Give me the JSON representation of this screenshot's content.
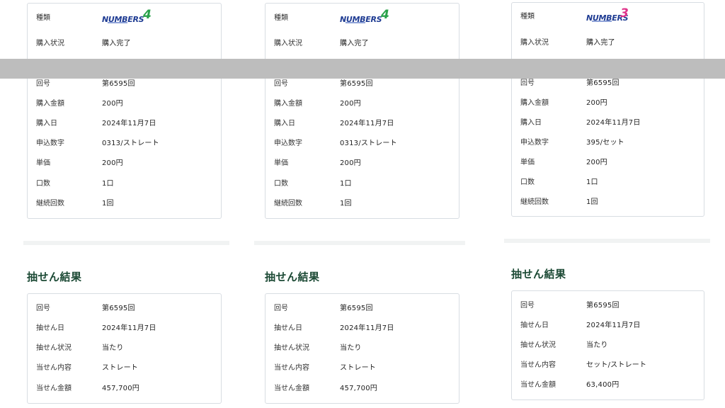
{
  "columns": [
    {
      "purchase": {
        "type_label": "種類",
        "logo_text": "NUMBERS",
        "logo_number": "4",
        "logo_number_color": "#2aa24a",
        "status_label": "購入状況",
        "status_value": "購入完了",
        "rows": [
          {
            "label": "回号",
            "value": "第6595回"
          },
          {
            "label": "購入金額",
            "value": "200円"
          },
          {
            "label": "購入日",
            "value": "2024年11月7日"
          },
          {
            "label": "申込数字",
            "value": "0313/ストレート"
          },
          {
            "label": "単価",
            "value": "200円"
          },
          {
            "label": "口数",
            "value": "1口"
          },
          {
            "label": "継続回数",
            "value": "1回"
          }
        ]
      },
      "result_heading": "抽せん結果",
      "result": [
        {
          "label": "回号",
          "value": "第6595回"
        },
        {
          "label": "抽せん日",
          "value": "2024年11月7日"
        },
        {
          "label": "抽せん状況",
          "value": "当たり"
        },
        {
          "label": "当せん内容",
          "value": "ストレート"
        },
        {
          "label": "当せん金額",
          "value": "457,700円"
        }
      ]
    },
    {
      "purchase": {
        "type_label": "種類",
        "logo_text": "NUMBERS",
        "logo_number": "4",
        "logo_number_color": "#2aa24a",
        "status_label": "購入状況",
        "status_value": "購入完了",
        "rows": [
          {
            "label": "回号",
            "value": "第6595回"
          },
          {
            "label": "購入金額",
            "value": "200円"
          },
          {
            "label": "購入日",
            "value": "2024年11月7日"
          },
          {
            "label": "申込数字",
            "value": "0313/ストレート"
          },
          {
            "label": "単価",
            "value": "200円"
          },
          {
            "label": "口数",
            "value": "1口"
          },
          {
            "label": "継続回数",
            "value": "1回"
          }
        ]
      },
      "result_heading": "抽せん結果",
      "result": [
        {
          "label": "回号",
          "value": "第6595回"
        },
        {
          "label": "抽せん日",
          "value": "2024年11月7日"
        },
        {
          "label": "抽せん状況",
          "value": "当たり"
        },
        {
          "label": "当せん内容",
          "value": "ストレート"
        },
        {
          "label": "当せん金額",
          "value": "457,700円"
        }
      ]
    },
    {
      "purchase": {
        "type_label": "種類",
        "logo_text": "NUMBERS",
        "logo_number": "3",
        "logo_number_color": "#e0338a",
        "status_label": "購入状況",
        "status_value": "購入完了",
        "rows": [
          {
            "label": "回号",
            "value": "第6595回"
          },
          {
            "label": "購入金額",
            "value": "200円"
          },
          {
            "label": "購入日",
            "value": "2024年11月7日"
          },
          {
            "label": "申込数字",
            "value": "395/セット"
          },
          {
            "label": "単価",
            "value": "200円"
          },
          {
            "label": "口数",
            "value": "1口"
          },
          {
            "label": "継続回数",
            "value": "1回"
          }
        ]
      },
      "result_heading": "抽せん結果",
      "result": [
        {
          "label": "回号",
          "value": "第6595回"
        },
        {
          "label": "抽せん日",
          "value": "2024年11月7日"
        },
        {
          "label": "抽せん状況",
          "value": "当たり"
        },
        {
          "label": "当せん内容",
          "value": "セット/ストレート"
        },
        {
          "label": "当せん金額",
          "value": "63,400円"
        }
      ]
    }
  ]
}
